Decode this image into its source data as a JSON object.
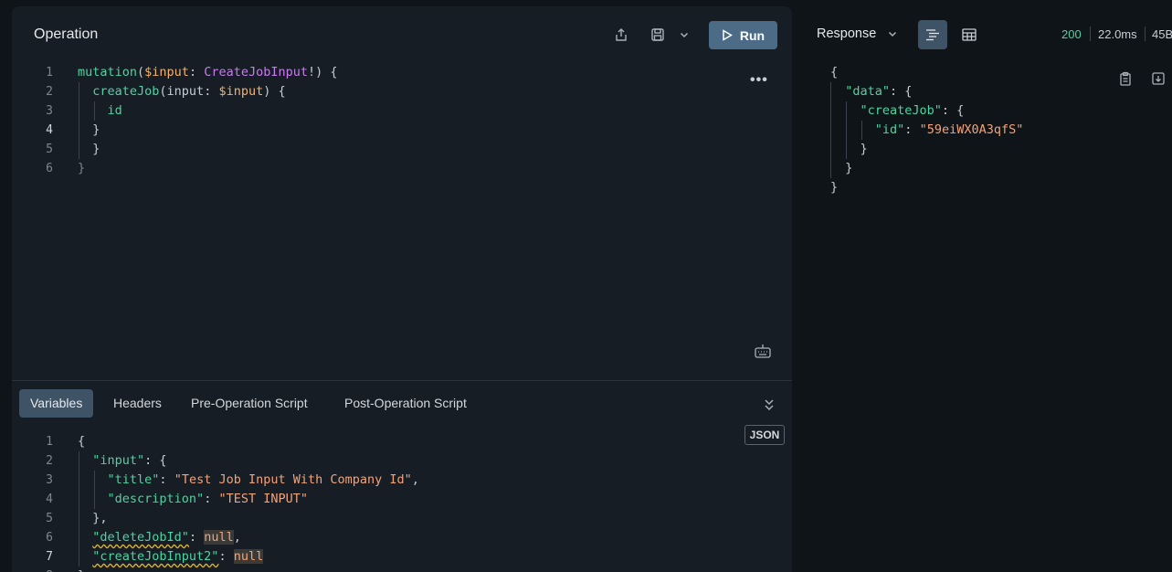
{
  "operation": {
    "title": "Operation",
    "run_label": "Run",
    "more_label": "•••",
    "lines": [
      [
        {
          "c": "k",
          "t": "mutation"
        },
        {
          "c": "p",
          "t": "("
        },
        {
          "c": "v",
          "t": "$input"
        },
        {
          "c": "p",
          "t": ": "
        },
        {
          "c": "t",
          "t": "CreateJobInput"
        },
        {
          "c": "p",
          "t": "!) {"
        }
      ],
      [
        {
          "c": "p",
          "t": "  "
        },
        {
          "c": "field",
          "t": "createJob"
        },
        {
          "c": "p",
          "t": "(input: "
        },
        {
          "c": "v",
          "t": "$input"
        },
        {
          "c": "p",
          "t": ") {"
        }
      ],
      [
        {
          "c": "p",
          "t": "    "
        },
        {
          "c": "field",
          "t": "id"
        }
      ],
      [
        {
          "c": "p",
          "t": "  }"
        }
      ],
      [
        {
          "c": "p",
          "t": "  }"
        }
      ],
      [
        {
          "c": "f",
          "t": "}"
        }
      ]
    ]
  },
  "variables": {
    "tabs": [
      "Variables",
      "Headers",
      "Pre-Operation Script",
      "Post-Operation Script"
    ],
    "active_tab": 0,
    "format_badge": "JSON",
    "lines": [
      [
        {
          "c": "p",
          "t": "{"
        }
      ],
      [
        {
          "c": "p",
          "t": "  "
        },
        {
          "c": "k",
          "t": "\"input\""
        },
        {
          "c": "p",
          "t": ": {"
        }
      ],
      [
        {
          "c": "p",
          "t": "    "
        },
        {
          "c": "k",
          "t": "\"title\""
        },
        {
          "c": "p",
          "t": ": "
        },
        {
          "c": "s",
          "t": "\"Test Job Input With Company Id\""
        },
        {
          "c": "p",
          "t": ","
        }
      ],
      [
        {
          "c": "p",
          "t": "    "
        },
        {
          "c": "k",
          "t": "\"description\""
        },
        {
          "c": "p",
          "t": ": "
        },
        {
          "c": "s",
          "t": "\"TEST INPUT\""
        }
      ],
      [
        {
          "c": "p",
          "t": "  },"
        }
      ],
      [
        {
          "c": "p",
          "t": "  "
        },
        {
          "c": "k wavy",
          "t": "\"deleteJobId\""
        },
        {
          "c": "p",
          "t": ": "
        },
        {
          "c": "nul",
          "t": "null"
        },
        {
          "c": "p",
          "t": ","
        }
      ],
      [
        {
          "c": "p",
          "t": "  "
        },
        {
          "c": "k wavy",
          "t": "\"createJobInput2\""
        },
        {
          "c": "p",
          "t": ": "
        },
        {
          "c": "nul",
          "t": "null"
        }
      ],
      [
        {
          "c": "p",
          "t": "}"
        }
      ]
    ]
  },
  "response": {
    "title": "Response",
    "status_code": "200",
    "time": "22.0ms",
    "size": "45B",
    "lines": [
      [
        {
          "c": "p",
          "t": "{"
        }
      ],
      [
        {
          "c": "p",
          "t": "  "
        },
        {
          "c": "k",
          "t": "\"data\""
        },
        {
          "c": "p",
          "t": ": {"
        }
      ],
      [
        {
          "c": "p",
          "t": "    "
        },
        {
          "c": "k",
          "t": "\"createJob\""
        },
        {
          "c": "p",
          "t": ": {"
        }
      ],
      [
        {
          "c": "p",
          "t": "      "
        },
        {
          "c": "k",
          "t": "\"id\""
        },
        {
          "c": "p",
          "t": ": "
        },
        {
          "c": "s",
          "t": "\"59eiWX0A3qfS\""
        }
      ],
      [
        {
          "c": "p",
          "t": "    }"
        }
      ],
      [
        {
          "c": "p",
          "t": "  }"
        }
      ],
      [
        {
          "c": "p",
          "t": "}"
        }
      ]
    ]
  }
}
